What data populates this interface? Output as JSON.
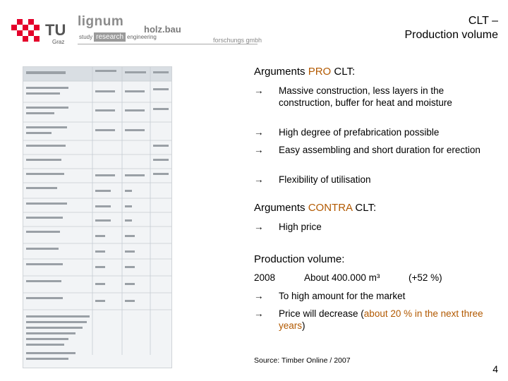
{
  "header": {
    "title_line1": "CLT –",
    "title_line2": "Production volume",
    "logo_tu": "TU",
    "logo_graz": "Graz",
    "logo_lignum": "lignum",
    "lignum_sub": [
      "study",
      "research",
      "engineering"
    ],
    "logo_holzbau": "holz.bau",
    "logo_forschung": "forschungs gmbh"
  },
  "pro": {
    "heading_prefix": "Arguments ",
    "heading_accent": "PRO",
    "heading_suffix": " CLT:",
    "items": [
      "Massive construction, less layers in the construction, buffer for heat and moisture",
      "High degree of prefabrication possible",
      "Easy assembling and short duration for erection",
      "Flexibility of utilisation"
    ]
  },
  "contra": {
    "heading_prefix": "Arguments ",
    "heading_accent": "CONTRA",
    "heading_suffix": " CLT:",
    "items": [
      "High price"
    ]
  },
  "production": {
    "heading": "Production volume:",
    "year": "2008",
    "amount": "About 400.000 m³",
    "change": "(+52 %)",
    "item1": "To high amount for the market",
    "item2_prefix": "Price will decrease (",
    "item2_accent": "about 20 % in the next three years",
    "item2_suffix": ")"
  },
  "arrow": "→",
  "source": "Source: Timber Online / 2007",
  "page_number": "4",
  "colors": {
    "accent": "#b25900",
    "tu_red": "#e4002b"
  }
}
